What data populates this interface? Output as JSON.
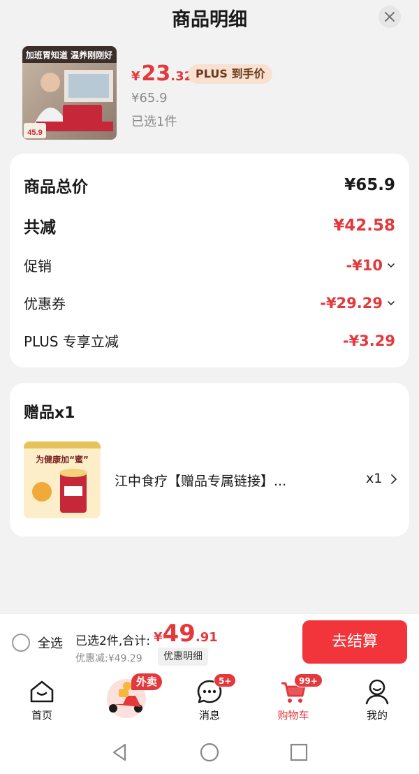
{
  "header": {
    "title": "商品明细"
  },
  "product": {
    "price_symbol": "¥",
    "price_int": "23",
    "price_dec": ".32",
    "plus_tag": "PLUS 到手价",
    "original_price": "¥65.9",
    "selected": "已选1件",
    "thumb_banner": "加班胃知道 温养刚刚好",
    "thumb_price": "45.9"
  },
  "summary": {
    "rows": [
      {
        "label": "商品总价",
        "value": "¥65.9"
      },
      {
        "label": "共减",
        "value": "¥42.58"
      },
      {
        "label": "促销",
        "value": "-¥10"
      },
      {
        "label": "优惠券",
        "value": "-¥29.29"
      },
      {
        "label": "PLUS 专享立减",
        "value": "-¥3.29"
      }
    ]
  },
  "gift": {
    "title": "赠品x1",
    "name": "江中食疗【赠品专属链接】...",
    "qty": "x1",
    "thumb_banner": "为健康加“蜜”"
  },
  "bottom": {
    "select_all": "全选",
    "total_text": "已选2件,合计:",
    "total_sym": "¥",
    "total_int": "49",
    "total_dec": ".91",
    "discount_text": "优惠减:¥49.29",
    "detail_button": "优惠明细",
    "checkout": "去结算"
  },
  "tabbar": {
    "home": "首页",
    "waimai_badge": "外卖",
    "messages": "消息",
    "messages_badge": "5+",
    "cart": "购物车",
    "cart_badge": "99+",
    "mine": "我的"
  },
  "colors": {
    "accent": "#e4393c",
    "checkout": "#f2353a",
    "plus_tag_bg": "#f8e1d1"
  }
}
